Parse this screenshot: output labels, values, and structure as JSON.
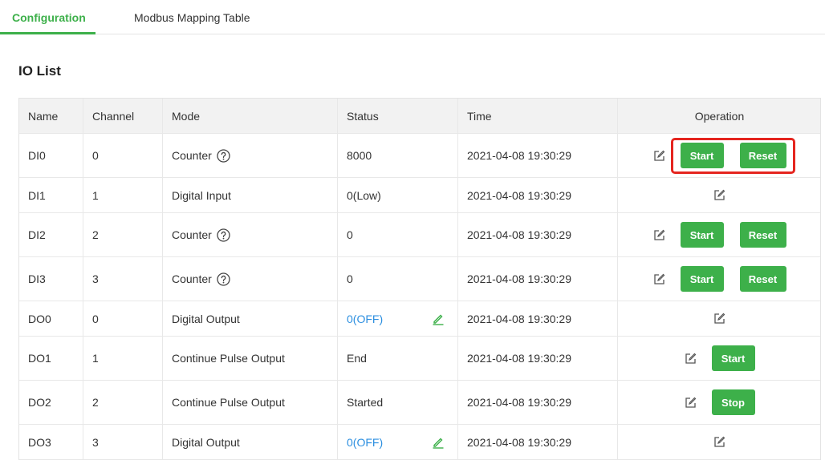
{
  "tabs": [
    {
      "label": "Configuration",
      "active": true
    },
    {
      "label": "Modbus Mapping Table",
      "active": false
    }
  ],
  "title": "IO List",
  "columns": [
    "Name",
    "Channel",
    "Mode",
    "Status",
    "Time",
    "Operation"
  ],
  "rows": [
    {
      "name": "DI0",
      "channel": "0",
      "mode": "Counter",
      "status": "8000",
      "time": "2021-04-08 19:30:29",
      "start": "Start",
      "reset": "Reset"
    },
    {
      "name": "DI1",
      "channel": "1",
      "mode": "Digital Input",
      "status": "0(Low)",
      "time": "2021-04-08 19:30:29"
    },
    {
      "name": "DI2",
      "channel": "2",
      "mode": "Counter",
      "status": "0",
      "time": "2021-04-08 19:30:29",
      "start": "Start",
      "reset": "Reset"
    },
    {
      "name": "DI3",
      "channel": "3",
      "mode": "Counter",
      "status": "0",
      "time": "2021-04-08 19:30:29",
      "start": "Start",
      "reset": "Reset"
    },
    {
      "name": "DO0",
      "channel": "0",
      "mode": "Digital Output",
      "status": "0(OFF)",
      "time": "2021-04-08 19:30:29"
    },
    {
      "name": "DO1",
      "channel": "1",
      "mode": "Continue Pulse Output",
      "status": "End",
      "time": "2021-04-08 19:30:29",
      "action": "Start"
    },
    {
      "name": "DO2",
      "channel": "2",
      "mode": "Continue Pulse Output",
      "status": "Started",
      "time": "2021-04-08 19:30:29",
      "action": "Stop"
    },
    {
      "name": "DO3",
      "channel": "3",
      "mode": "Digital Output",
      "status": "0(OFF)",
      "time": "2021-04-08 19:30:29"
    }
  ],
  "colors": {
    "accent": "#3db04a",
    "link": "#2c8fe0",
    "highlight": "#e5251f"
  }
}
